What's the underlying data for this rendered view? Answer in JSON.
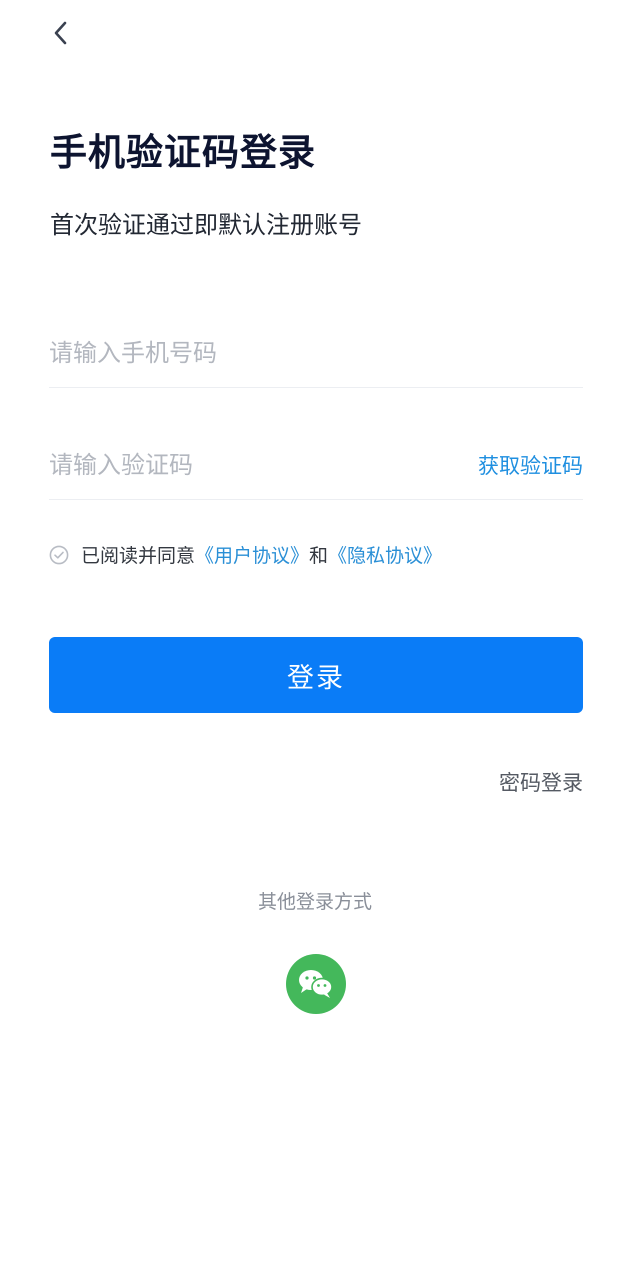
{
  "header": {
    "back_icon": "chevron-left-icon"
  },
  "page": {
    "title": "手机验证码登录",
    "subtitle": "首次验证通过即默认注册账号"
  },
  "form": {
    "phone": {
      "value": "",
      "placeholder": "请输入手机号码"
    },
    "code": {
      "value": "",
      "placeholder": "请输入验证码",
      "get_code_label": "获取验证码"
    }
  },
  "agreement": {
    "checked": false,
    "check_icon": "check-circle-icon",
    "prefix": "已阅读并同意",
    "user_agreement": "《用户协议》",
    "conjunction": "和",
    "privacy_policy": "《隐私协议》"
  },
  "actions": {
    "login_label": "登录",
    "password_login_label": "密码登录"
  },
  "other_login": {
    "label": "其他登录方式",
    "wechat_icon": "wechat-icon"
  },
  "colors": {
    "primary": "#0a7cf7",
    "link": "#2a8fd6",
    "title": "#0d1430",
    "placeholder": "#b3b7bf",
    "wechat": "#44b85b"
  }
}
